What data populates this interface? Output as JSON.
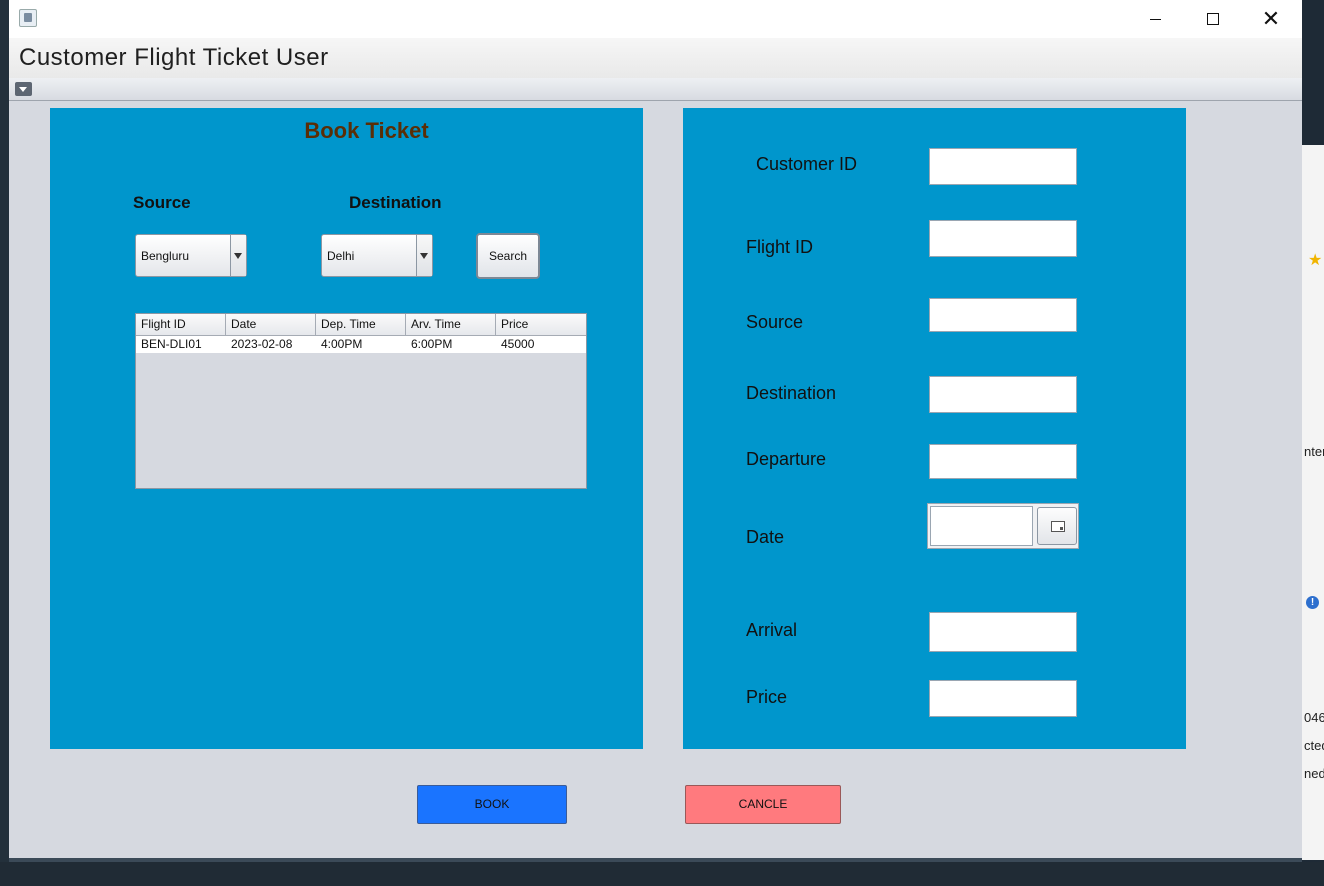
{
  "window": {
    "title": "Customer Flight Ticket User",
    "controls": {
      "minimize": "–",
      "maximize": "☐",
      "close": "✕"
    }
  },
  "book_panel": {
    "title": "Book Ticket",
    "source_label": "Source",
    "destination_label": "Destination",
    "source_value": "Bengluru",
    "destination_value": "Delhi",
    "search_label": "Search",
    "table": {
      "columns": [
        "Flight ID",
        "Date",
        "Dep. Time",
        "Arv. Time",
        "Price"
      ],
      "rows": [
        [
          "BEN-DLI01",
          "2023-02-08",
          "4:00PM",
          "6:00PM",
          "45000"
        ]
      ]
    }
  },
  "details_panel": {
    "fields": {
      "customer_id": {
        "label": "Customer ID",
        "value": ""
      },
      "flight_id": {
        "label": "Flight ID",
        "value": ""
      },
      "source": {
        "label": "Source",
        "value": ""
      },
      "destination": {
        "label": "Destination",
        "value": ""
      },
      "departure": {
        "label": "Departure",
        "value": ""
      },
      "date": {
        "label": "Date",
        "value": ""
      },
      "arrival": {
        "label": "Arrival",
        "value": ""
      },
      "price": {
        "label": "Price",
        "value": ""
      }
    }
  },
  "actions": {
    "book_label": "BOOK",
    "cancel_label": "CANCLE"
  },
  "colors": {
    "panel_bg": "#0096cc",
    "title_color": "#5a2e06",
    "book_button": "#1a74ff",
    "cancel_button": "#ff7a7e",
    "window_bg": "#d6d9e0"
  },
  "background_fragments": [
    "ntem",
    "046",
    "cted",
    "ned"
  ]
}
